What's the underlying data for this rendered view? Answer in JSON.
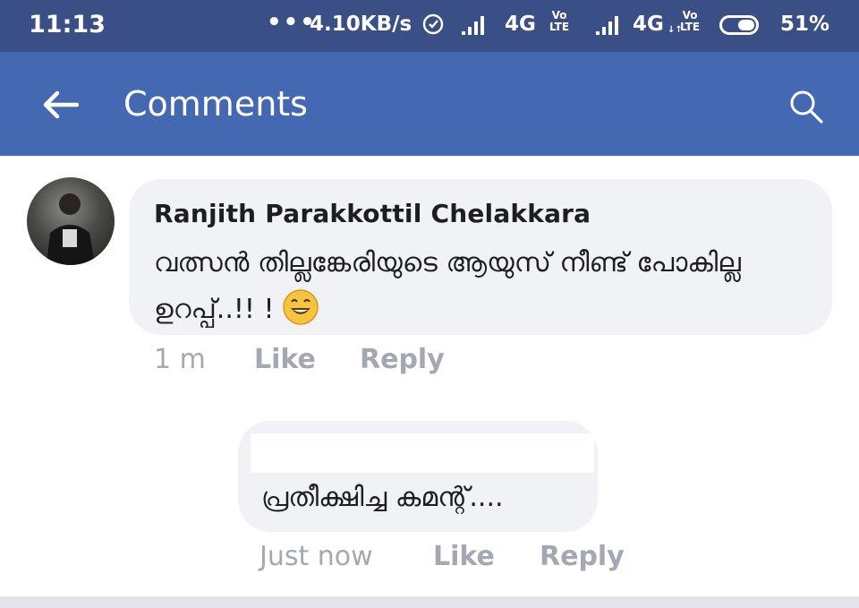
{
  "status_bar": {
    "time": "11:13",
    "dots": "•••",
    "speed": "4.10KB/s",
    "network1": "4G",
    "network2": "4G",
    "volte_top": "Vo",
    "volte_bottom": "LTE",
    "arrows": "↓↑",
    "battery": "51%"
  },
  "app_bar": {
    "title": "Comments",
    "color": "#4568b2"
  },
  "comments": [
    {
      "author": "Ranjith Parakkottil Chelakkara",
      "text": "വത്സൻ തില്ലങ്കേരിയുടെ ആയുസ് നീണ്ട് പോകില്ല ഉറപ്പ്..!! !",
      "time": "1 m",
      "like": "Like",
      "reply": "Reply"
    },
    {
      "text": "പ്രതീക്ഷിച്ച കമന്റ്....",
      "time": "Just now",
      "like": "Like",
      "reply": "Reply"
    }
  ],
  "icons": {
    "back": "arrow-left-icon",
    "search": "search-icon",
    "emoji": "smiling-face-icon"
  }
}
